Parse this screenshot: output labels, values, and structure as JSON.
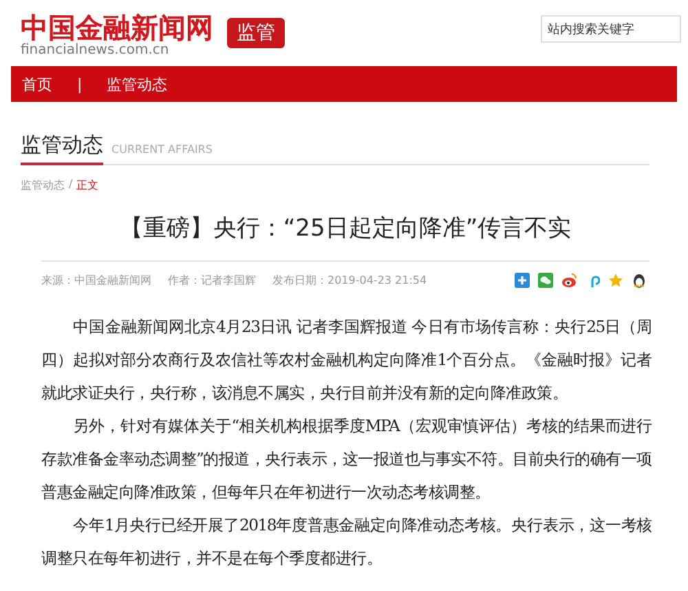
{
  "header": {
    "logo_title": "中国金融新闻网",
    "logo_domain": "financialnews.com.cn",
    "channel_badge": "监管",
    "search": {
      "placeholder": "站内搜索关键字"
    }
  },
  "nav": {
    "items": [
      "首页",
      "监管动态"
    ],
    "separator": "|"
  },
  "section": {
    "title": "监管动态",
    "subtitle": "CURRENT AFFAIRS"
  },
  "breadcrumb": [
    {
      "label": "监管动态",
      "selected": false
    },
    {
      "label": "正文",
      "selected": true
    }
  ],
  "breadcrumb_separator": "/",
  "article": {
    "title": "【重磅】央行：“25日起定向降准”传言不实",
    "meta": [
      "来源：中国金融新闻网",
      "作者：记者李国辉",
      "发布日期：2019-04-23 21:54"
    ],
    "paragraphs": [
      "中国金融新闻网北京4月23日讯 记者李国辉报道 今日有市场传言称：央行25日（周四）起拟对部分农商行及农信社等农村金融机构定向降准1个百分点。《金融时报》记者就此求证央行，央行称，该消息不属实，央行目前并没有新的定向降准政策。",
      "另外，针对有媒体关于“相关机构根据季度MPA（宏观审慎评估）考核的结果而进行存款准备金率动态调整”的报道，央行表示，这一报道也与事实不符。目前央行的确有一项普惠金融定向降准政策，但每年只在年初进行一次动态考核调整。",
      "今年1月央行已经开展了2018年度普惠金融定向降准动态考核。央行表示，这一考核调整只在每年初进行，并不是在每个季度都进行。"
    ]
  }
}
